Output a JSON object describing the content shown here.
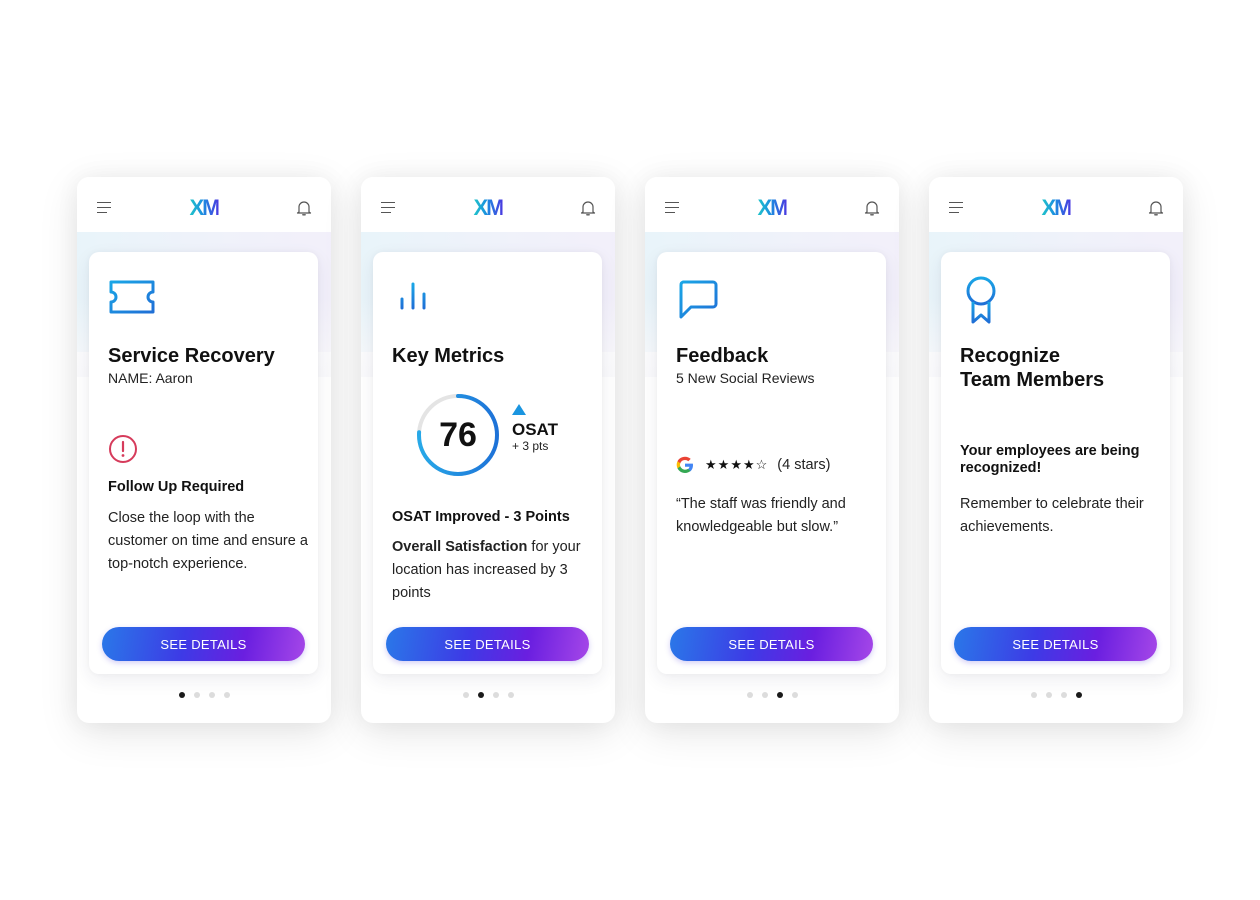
{
  "app": {
    "logo_text": "XM",
    "menu_icon": "hamburger-menu-icon",
    "notification_icon": "bell-icon",
    "button_label": "SEE DETAILS",
    "brand_colors": {
      "logo_start": "#20c6c9",
      "logo_end": "#4a3ae0",
      "button_start": "#2a78e8",
      "button_end": "#a547e8",
      "icon_blue": "#1a8fe0",
      "alert_red": "#d63b5b"
    }
  },
  "screens": [
    {
      "icon": "ticket-icon",
      "title": "Service Recovery",
      "subtitle": "NAME: Aaron",
      "alert_icon": "alert-circle-icon",
      "bold_line": "Follow Up Required",
      "body": "Close the loop with the customer on time and ensure a top-notch experience.",
      "button_label": "SEE DETAILS",
      "page_index": 1,
      "page_count": 4
    },
    {
      "icon": "bar-chart-icon",
      "title": "Key Metrics",
      "gauge": {
        "value": "76",
        "fraction": 0.76,
        "trend_icon": "up-triangle-icon",
        "metric": "OSAT",
        "delta": "+ 3 pts"
      },
      "bold_line": "OSAT Improved - 3 Points",
      "body_bold": "Overall Satisfaction",
      "body_rest": " for your location has increased by 3 points",
      "button_label": "SEE DETAILS",
      "page_index": 2,
      "page_count": 4
    },
    {
      "icon": "chat-bubble-icon",
      "title": "Feedback",
      "subtitle": "5 New Social Reviews",
      "review": {
        "source_icon": "google-icon",
        "rating": 4,
        "max_rating": 5,
        "rating_label": "(4 stars)",
        "quote": "“The staff was friendly and knowledgeable but slow.”"
      },
      "button_label": "SEE DETAILS",
      "page_index": 3,
      "page_count": 4
    },
    {
      "icon": "award-ribbon-icon",
      "title_line1": "Recognize",
      "title_line2": "Team Members",
      "bold_line": "Your employees are being recognized!",
      "body": "Remember to celebrate their achievements.",
      "button_label": "SEE DETAILS",
      "page_index": 4,
      "page_count": 4
    }
  ]
}
